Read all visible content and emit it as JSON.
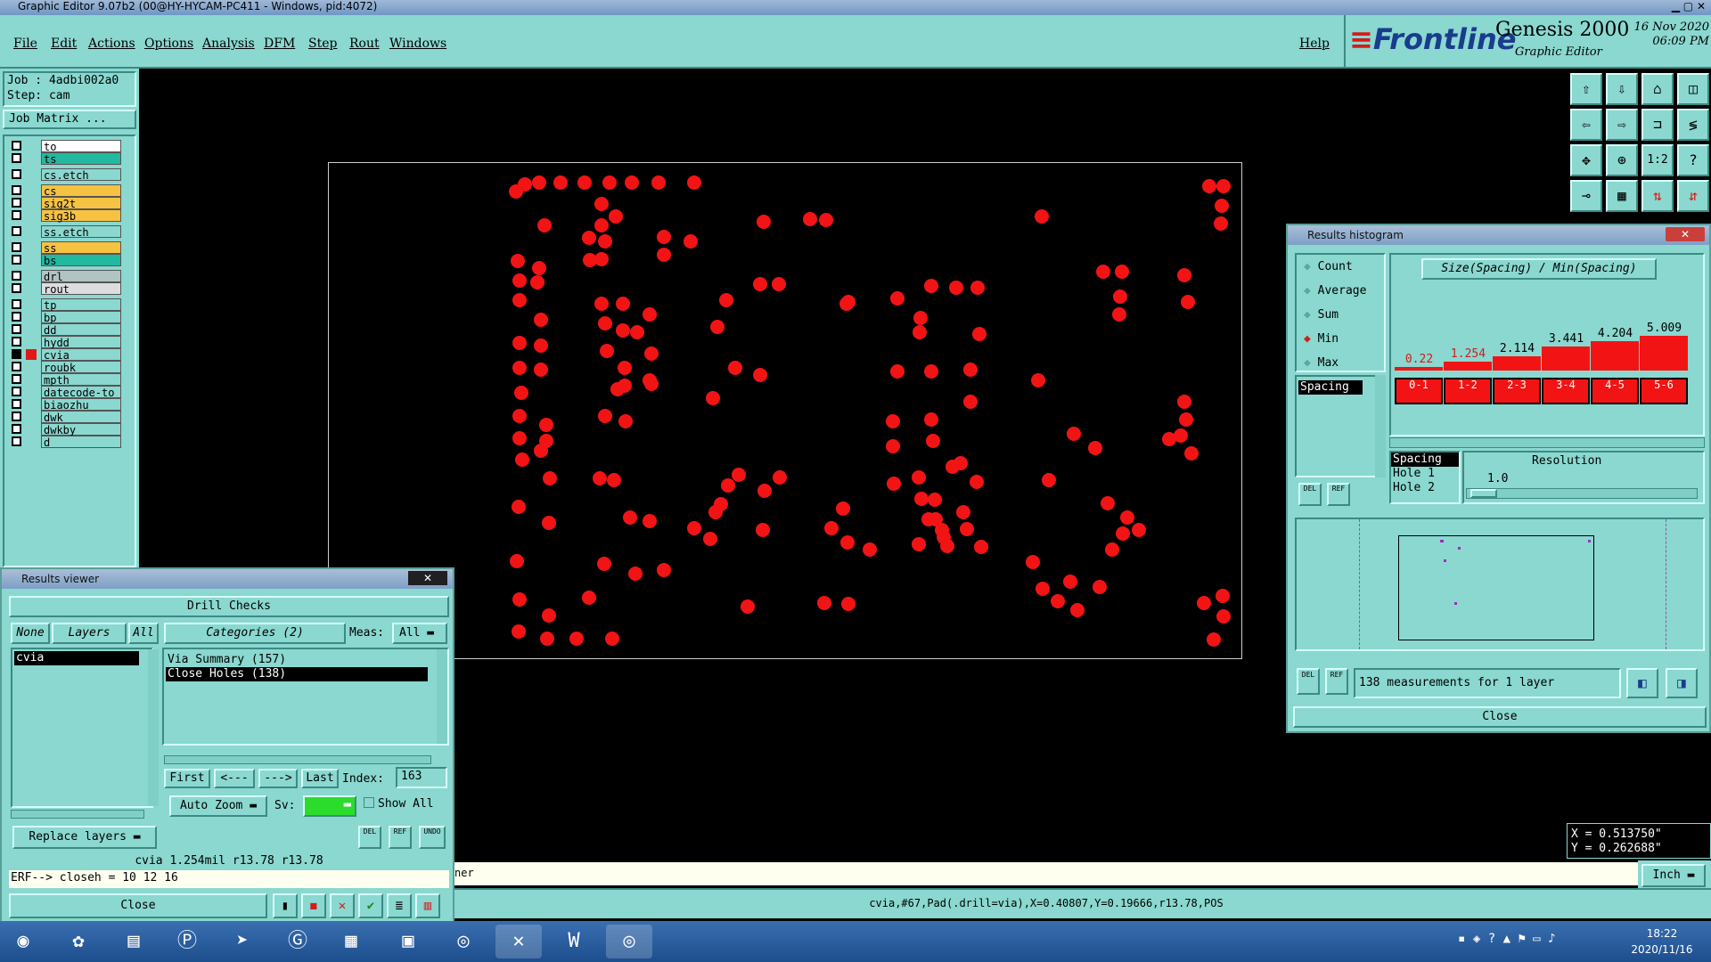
{
  "window_title": "Graphic Editor 9.07b2 (00@HY-HYCAM-PC411 - Windows, pid:4072)",
  "menu": [
    "File",
    "Edit",
    "Actions",
    "Options",
    "Analysis",
    "DFM",
    "Step",
    "Rout",
    "Windows"
  ],
  "help": "Help",
  "brand": {
    "logo": "Frontline",
    "product": "Genesis 2000",
    "subtitle": "Graphic Editor",
    "date": "16 Nov 2020",
    "time": "06:09 PM"
  },
  "job": {
    "job_label": "Job : 4adbi002a0",
    "step_label": "Step: cam",
    "matrix_button": "Job Matrix ..."
  },
  "layers": [
    {
      "name": "to",
      "color": "#ffffff"
    },
    {
      "name": "ts",
      "color": "#22b9a0"
    },
    {
      "name": "cs.etch",
      "color": "#8ad8d0"
    },
    {
      "name": "cs",
      "color": "#f5c242"
    },
    {
      "name": "sig2t",
      "color": "#f5c242"
    },
    {
      "name": "sig3b",
      "color": "#f5c242"
    },
    {
      "name": "ss.etch",
      "color": "#8ad8d0"
    },
    {
      "name": "ss",
      "color": "#f5c242"
    },
    {
      "name": "bs",
      "color": "#22b9a0"
    },
    {
      "name": "drl",
      "color": "#b0c4c4"
    },
    {
      "name": "rout",
      "color": "#dddddd"
    },
    {
      "name": "tp",
      "color": "#8ad8d0"
    },
    {
      "name": "bp",
      "color": "#8ad8d0"
    },
    {
      "name": "dd",
      "color": "#8ad8d0"
    },
    {
      "name": "hydd",
      "color": "#8ad8d0"
    },
    {
      "name": "cvia",
      "color": "#8ad8d0"
    },
    {
      "name": "roubk",
      "color": "#8ad8d0"
    },
    {
      "name": "mpth",
      "color": "#8ad8d0"
    },
    {
      "name": "datecode-to",
      "color": "#8ad8d0"
    },
    {
      "name": "biaozhu",
      "color": "#8ad8d0"
    },
    {
      "name": "dwk",
      "color": "#8ad8d0"
    },
    {
      "name": "dwkby",
      "color": "#8ad8d0"
    },
    {
      "name": "d",
      "color": "#8ad8d0"
    }
  ],
  "histogram": {
    "title": "Results histogram",
    "modes": [
      "Count",
      "Average",
      "Sum",
      "Min",
      "Max"
    ],
    "selected_mode": "Min",
    "list_item": "Spacing",
    "chart_title": "Size(Spacing) / Min(Spacing)",
    "bins": [
      "0-1",
      "1-2",
      "2-3",
      "3-4",
      "4-5",
      "5-6"
    ],
    "values": [
      0.22,
      1.254,
      2.114,
      3.441,
      4.204,
      5.009
    ],
    "value_labels": [
      "0.22",
      "1.254",
      "2.114",
      "3.441",
      "4.204",
      "5.009"
    ],
    "resolution_list": [
      "Spacing",
      "Hole 1",
      "Hole 2"
    ],
    "resolution_label": "Resolution",
    "resolution_value": "1.0",
    "del": "DEL",
    "ref": "REF",
    "summary": "138 measurements for 1 layer",
    "close": "Close"
  },
  "results": {
    "title": "Results viewer",
    "header": "Drill Checks",
    "none": "None",
    "layers": "Layers",
    "all": "All",
    "categories": "Categories (2)",
    "meas_label": "Meas:",
    "meas_value": "All",
    "layer_items": [
      "cvia"
    ],
    "category_items": [
      "Via Summary (157)",
      "Close Holes (138)"
    ],
    "first": "First",
    "prev": "<---",
    "next": "--->",
    "last": "Last",
    "index_label": "Index:",
    "index_value": "163",
    "auto_zoom": "Auto Zoom",
    "sv_label": "Sv:",
    "show_all": "Show All",
    "del": "DEL",
    "ref": "REF",
    "undo": "UNDO",
    "replace_layers": "Replace layers",
    "info": "cvia 1.254mil  r13.78  r13.78",
    "erf": "ERF--> closeh = 10 12 16",
    "close": "Close"
  },
  "coords": {
    "x": "X = 0.513750\"",
    "y": "Y = 0.262688\""
  },
  "units": "Inch",
  "status_partial": "ner",
  "status_text": "cvia,#67,Pad(.drill=via),X=0.40807,Y=0.19666,r13.78,POS",
  "tray": {
    "time": "18:22",
    "date": "2020/11/16"
  }
}
